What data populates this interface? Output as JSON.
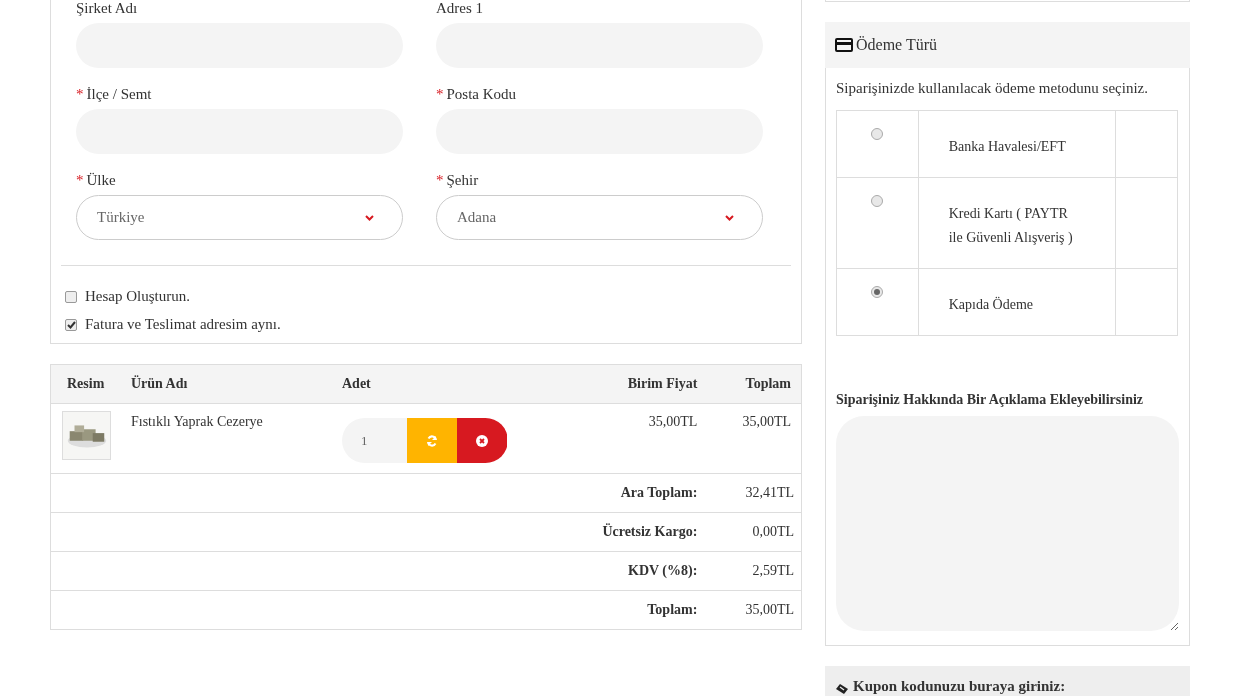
{
  "address_form": {
    "fields": [
      {
        "label": "Şirket Adı",
        "required": false,
        "kind": "text"
      },
      {
        "label": "Adres 1",
        "required": false,
        "kind": "text"
      },
      {
        "label": "İlçe / Semt",
        "required": true,
        "kind": "text"
      },
      {
        "label": "Posta Kodu",
        "required": true,
        "kind": "text"
      },
      {
        "label": "Ülke",
        "required": true,
        "kind": "select",
        "value": "Türkiye"
      },
      {
        "label": "Şehir",
        "required": true,
        "kind": "select",
        "value": "Adana"
      }
    ],
    "required_mark": "*",
    "options": [
      {
        "label": "Hesap Oluşturun.",
        "checked": false
      },
      {
        "label": "Fatura ve Teslimat adresim aynı.",
        "checked": true
      }
    ]
  },
  "cart": {
    "columns": [
      "Resim",
      "Ürün Adı",
      "Adet",
      "Birim Fiyat",
      "Toplam"
    ],
    "rows": [
      {
        "name": "Fıstıklı Yaprak Cezerye",
        "quantity": "1",
        "unit_price": "35,00TL",
        "total": "35,00TL"
      }
    ],
    "summary": [
      {
        "label": "Ara Toplam:",
        "value": "32,41TL"
      },
      {
        "label": "Ücretsiz Kargo:",
        "value": "0,00TL"
      },
      {
        "label": "KDV (%8):",
        "value": "2,59TL"
      },
      {
        "label": "Toplam:",
        "value": "35,00TL"
      }
    ]
  },
  "payment": {
    "title": "Ödeme Türü",
    "instruction": "Siparişinizde kullanılacak ödeme metodunu seçiniz.",
    "methods": [
      {
        "lines": [
          "Banka Havalesi/EFT"
        ],
        "selected": false
      },
      {
        "lines": [
          "Kredi Kartı ( PAYTR",
          "ile Güvenli Alışveriş )"
        ],
        "selected": false
      },
      {
        "lines": [
          "Kapıda Ödeme"
        ],
        "selected": true
      }
    ],
    "note_label": "Siparişiniz Hakkında Bir Açıklama Ekleyebilirsiniz"
  },
  "coupon": {
    "title": "Kupon kodunuzu buraya giriniz:"
  }
}
